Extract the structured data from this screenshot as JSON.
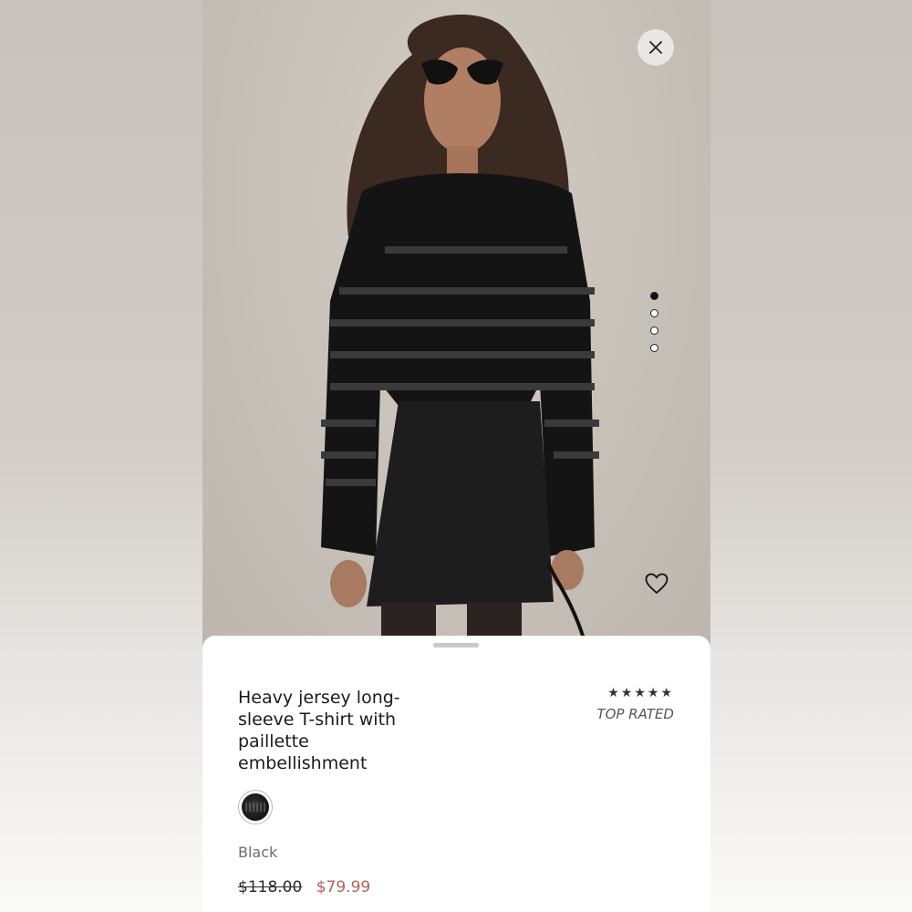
{
  "product": {
    "title": "Heavy jersey long-sleeve T-shirt with paillette embellishment",
    "rating_stars": "★★★★★",
    "rating_label": "TOP RATED",
    "color_name": "Black",
    "price_original": "$118.00",
    "price_sale": "$79.99"
  },
  "gallery": {
    "image_count": 4,
    "active_index": 0
  },
  "icons": {
    "close": "close-icon",
    "favorite": "heart-outline-icon"
  },
  "colors": {
    "sale_price": "#b4615b",
    "sheet_bg": "#ffffff"
  }
}
